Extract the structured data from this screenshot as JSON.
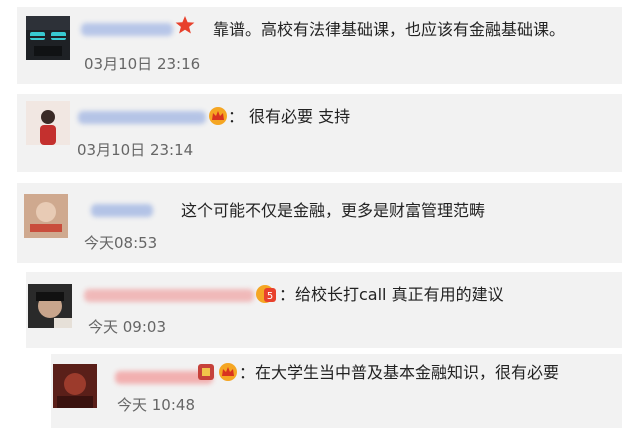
{
  "comments": [
    {
      "prefix": "",
      "text": "靠谱。高校有法律基础课，也应该有金融基础课。",
      "time": "03月10日 23:16",
      "badge_icon": "star-icon"
    },
    {
      "prefix": "：",
      "text": "很有必要 支持",
      "time": "03月10日 23:14",
      "badge_icon": "crown-icon"
    },
    {
      "prefix": "",
      "text": "这个可能不仅是金融，更多是财富管理范畴",
      "time": "今天08:53",
      "badge_icon": ""
    },
    {
      "prefix": "",
      "text": "：给校长打call 真正有用的建议",
      "time": "今天 09:03",
      "badge_icon": "level-badge-icon"
    },
    {
      "prefix": "",
      "text": "：在大学生当中普及基本金融知识，很有必要",
      "time": "今天 10:48",
      "badge_icon": "crown-icon"
    }
  ],
  "colors": {
    "card_bg": "#f2f2f2",
    "star": "#e8412c",
    "crown": "#f5a623",
    "time": "#666666"
  }
}
